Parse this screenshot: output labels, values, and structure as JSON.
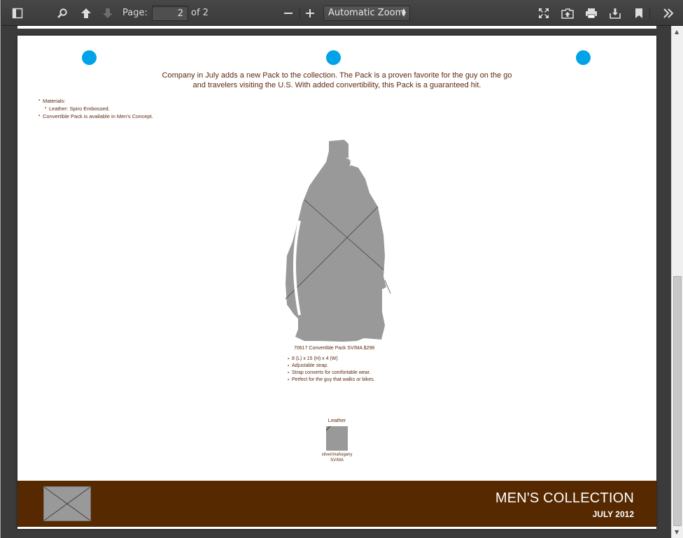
{
  "toolbar": {
    "page_label": "Page:",
    "page_value": "2",
    "page_of": "of 2",
    "zoom_value": "Automatic Zoom",
    "zoom_minus": "−",
    "zoom_plus": "+"
  },
  "page": {
    "intro_line1": "Company in July adds a new Pack to the collection. The Pack is a proven favorite for the guy on the go",
    "intro_line2": "and travelers visiting the U.S. With added convertibility, this  Pack is a guaranteed hit.",
    "materials": {
      "item1": "Materials:",
      "item1_sub": "Leather: Spiro Embossed.",
      "item2": "Convertible  Pack is available in Men's Concept."
    },
    "product_caption": "70617  Convertible  Pack SV/MA  $298",
    "features": [
      "8 (L) x 15 (H) x 4 (W)",
      "Adjustable strap.",
      "Strap converts for comfortable wear.",
      "Perfect for the guy that walks or bikes."
    ],
    "swatch": {
      "title": "Leather",
      "name_line1": "silver/mahogany",
      "name_line2": "SV/MA"
    },
    "footer": {
      "title": "MEN'S COLLECTION",
      "date": "JULY 2012"
    }
  },
  "colors": {
    "accent_dot": "#00a3e8",
    "text_brown": "#5a2a10",
    "footer_bg": "#562900"
  }
}
